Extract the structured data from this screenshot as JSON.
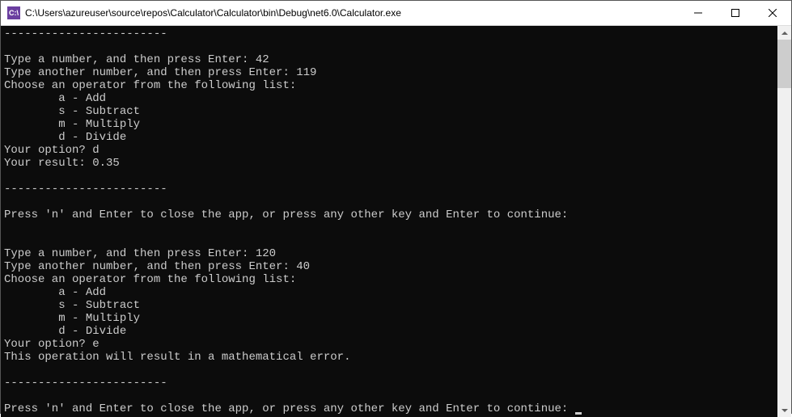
{
  "titlebar": {
    "icon_label": "C:\\",
    "title": "C:\\Users\\azureuser\\source\\repos\\Calculator\\Calculator\\bin\\Debug\\net6.0\\Calculator.exe"
  },
  "console": {
    "lines": [
      "------------------------",
      "",
      "Type a number, and then press Enter: 42",
      "Type another number, and then press Enter: 119",
      "Choose an operator from the following list:",
      "        a - Add",
      "        s - Subtract",
      "        m - Multiply",
      "        d - Divide",
      "Your option? d",
      "Your result: 0.35",
      "",
      "------------------------",
      "",
      "Press 'n' and Enter to close the app, or press any other key and Enter to continue:",
      "",
      "",
      "Type a number, and then press Enter: 120",
      "Type another number, and then press Enter: 40",
      "Choose an operator from the following list:",
      "        a - Add",
      "        s - Subtract",
      "        m - Multiply",
      "        d - Divide",
      "Your option? e",
      "This operation will result in a mathematical error.",
      "",
      "------------------------",
      ""
    ],
    "last_line": "Press 'n' and Enter to close the app, or press any other key and Enter to continue: "
  }
}
